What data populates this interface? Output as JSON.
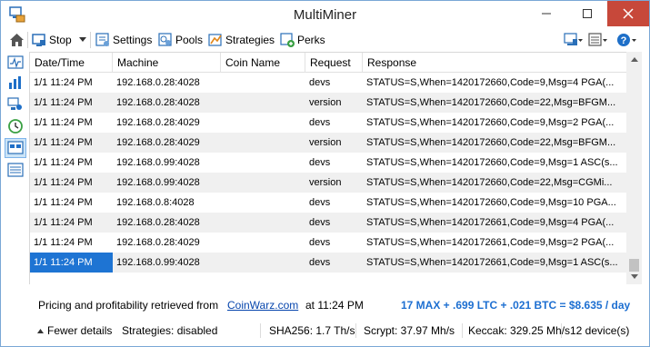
{
  "window": {
    "title": "MultiMiner"
  },
  "toolbar": {
    "stop_label": "Stop",
    "settings_label": "Settings",
    "pools_label": "Pools",
    "strategies_label": "Strategies",
    "perks_label": "Perks"
  },
  "grid": {
    "columns": [
      "Date/Time",
      "Machine",
      "Coin Name",
      "Request",
      "Response"
    ],
    "rows": [
      {
        "datetime": "1/1 11:24 PM",
        "machine": "192.168.0.28:4028",
        "coin": "",
        "request": "devs",
        "response": "STATUS=S,When=1420172660,Code=9,Msg=4 PGA(..."
      },
      {
        "datetime": "1/1 11:24 PM",
        "machine": "192.168.0.28:4028",
        "coin": "",
        "request": "version",
        "response": "STATUS=S,When=1420172660,Code=22,Msg=BFGM..."
      },
      {
        "datetime": "1/1 11:24 PM",
        "machine": "192.168.0.28:4029",
        "coin": "",
        "request": "devs",
        "response": "STATUS=S,When=1420172660,Code=9,Msg=2 PGA(..."
      },
      {
        "datetime": "1/1 11:24 PM",
        "machine": "192.168.0.28:4029",
        "coin": "",
        "request": "version",
        "response": "STATUS=S,When=1420172660,Code=22,Msg=BFGM..."
      },
      {
        "datetime": "1/1 11:24 PM",
        "machine": "192.168.0.99:4028",
        "coin": "",
        "request": "devs",
        "response": "STATUS=S,When=1420172660,Code=9,Msg=1 ASC(s..."
      },
      {
        "datetime": "1/1 11:24 PM",
        "machine": "192.168.0.99:4028",
        "coin": "",
        "request": "version",
        "response": "STATUS=S,When=1420172660,Code=22,Msg=CGMi..."
      },
      {
        "datetime": "1/1 11:24 PM",
        "machine": "192.168.0.8:4028",
        "coin": "",
        "request": "devs",
        "response": "STATUS=S,When=1420172660,Code=9,Msg=10 PGA..."
      },
      {
        "datetime": "1/1 11:24 PM",
        "machine": "192.168.0.28:4028",
        "coin": "",
        "request": "devs",
        "response": "STATUS=S,When=1420172661,Code=9,Msg=4 PGA(..."
      },
      {
        "datetime": "1/1 11:24 PM",
        "machine": "192.168.0.28:4029",
        "coin": "",
        "request": "devs",
        "response": "STATUS=S,When=1420172661,Code=9,Msg=2 PGA(..."
      },
      {
        "datetime": "1/1 11:24 PM",
        "machine": "192.168.0.99:4028",
        "coin": "",
        "request": "devs",
        "response": "STATUS=S,When=1420172661,Code=9,Msg=1 ASC(s..."
      }
    ]
  },
  "info": {
    "label": "Pricing and profitability retrieved from",
    "link": "CoinWarz.com",
    "time": "at 11:24 PM",
    "profit": "17 MAX + .699 LTC + .021 BTC = $8.635 / day"
  },
  "status": {
    "fewer_details": "Fewer details",
    "strategies": "Strategies: disabled",
    "sha256": "SHA256: 1.7 Th/s",
    "scrypt": "Scrypt: 37.97 Mh/s",
    "keccak": "Keccak: 329.25 Mh/s",
    "devices": "12 device(s)"
  },
  "icons": {
    "home": "home-icon",
    "stop": "stop-icon",
    "settings": "settings-icon",
    "pools": "pools-icon",
    "strategies": "strategies-icon",
    "perks": "perks-icon",
    "view": "view-icon",
    "details": "details-icon",
    "help": "help-icon"
  },
  "colors": {
    "selection": "#1e74d3",
    "profit": "#1d6fd1",
    "close": "#c7483a",
    "link": "#0645ad"
  }
}
